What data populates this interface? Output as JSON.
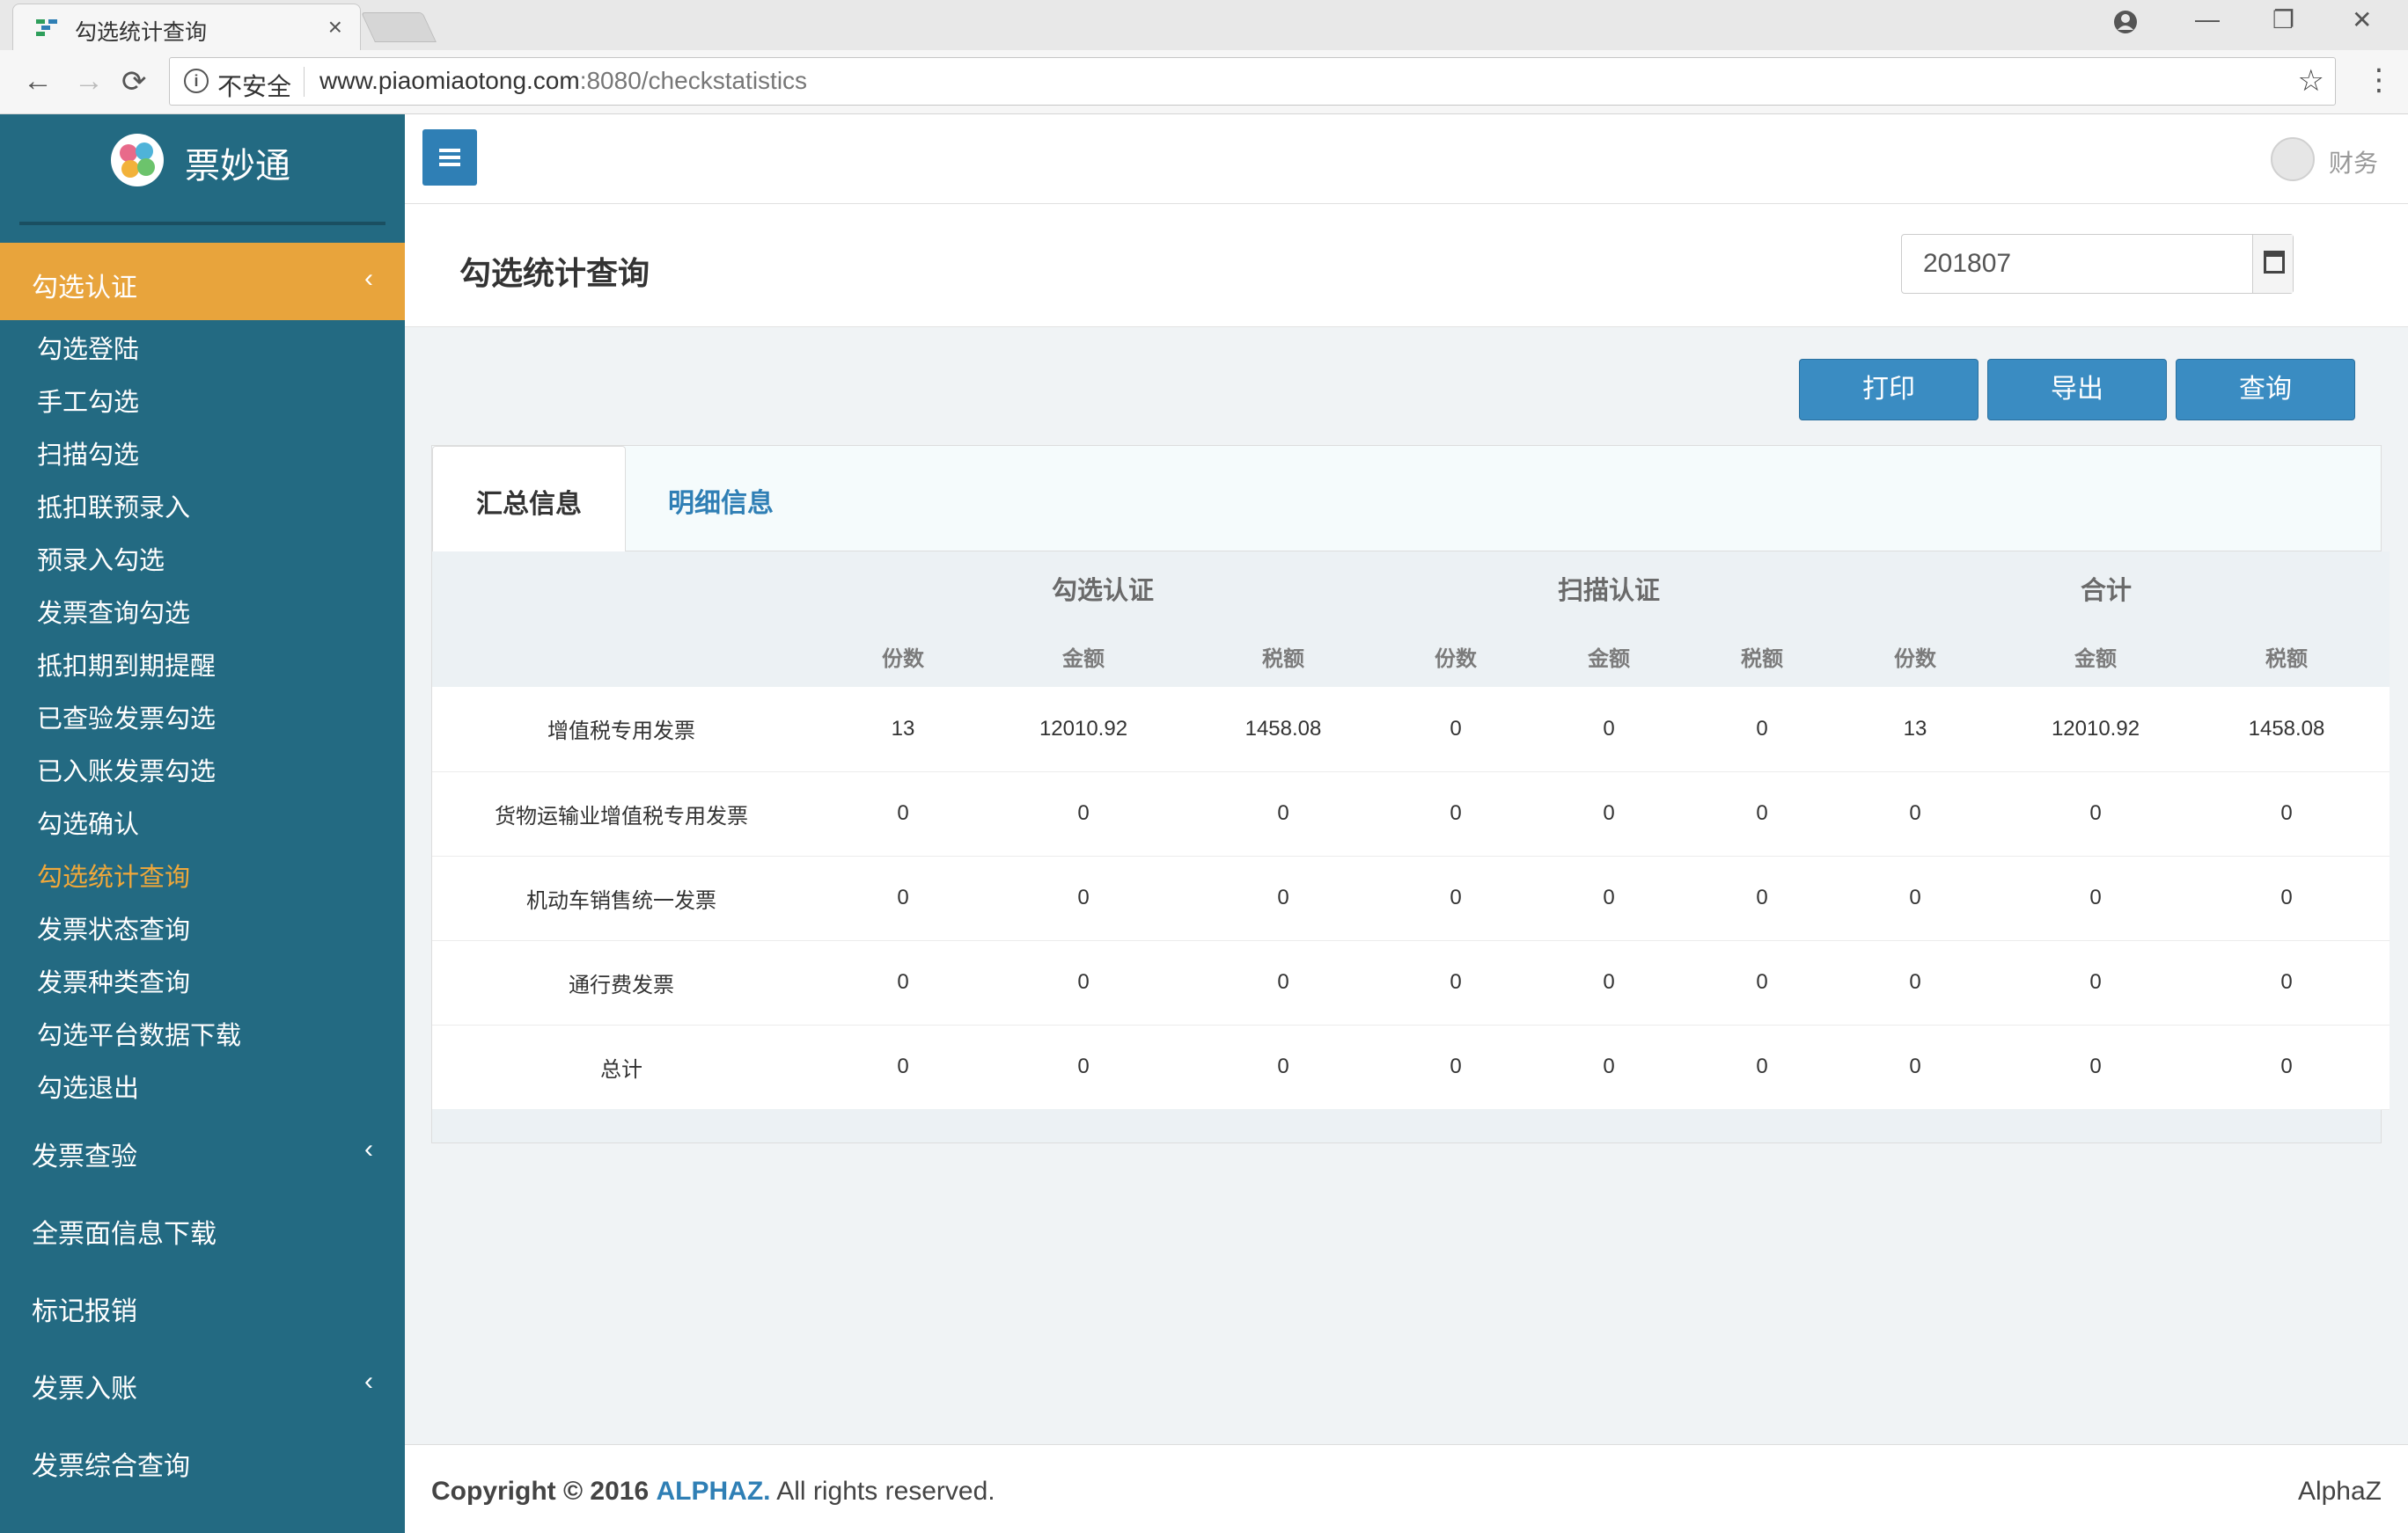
{
  "browser": {
    "tab_title": "勾选统计查询",
    "tab_close": "×",
    "insecure_label": "不安全",
    "url_host": "www.piaomiaotong.com",
    "url_rest": ":8080/checkstatistics",
    "back": "←",
    "forward": "→",
    "reload": "⟳",
    "star": "☆",
    "menu": "⋮",
    "minimize": "—",
    "restore": "❐",
    "close": "✕"
  },
  "sidebar": {
    "brand": "票妙通",
    "active_section": "勾选认证",
    "sub_items": [
      "勾选登陆",
      "手工勾选",
      "扫描勾选",
      "抵扣联预录入",
      "预录入勾选",
      "发票查询勾选",
      "抵扣期到期提醒",
      "已查验发票勾选",
      "已入账发票勾选",
      "勾选确认",
      "勾选统计查询",
      "发票状态查询",
      "发票种类查询",
      "勾选平台数据下载",
      "勾选退出"
    ],
    "top_items": [
      "发票查验",
      "全票面信息下载",
      "标记报销",
      "发票入账",
      "发票综合查询"
    ],
    "chevron": "‹"
  },
  "header": {
    "user": "财务"
  },
  "page": {
    "title": "勾选统计查询",
    "period_value": "201807",
    "buttons": {
      "print": "打印",
      "export": "导出",
      "query": "查询"
    }
  },
  "tabs": {
    "summary": "汇总信息",
    "detail": "明细信息"
  },
  "table": {
    "groups": [
      "勾选认证",
      "扫描认证",
      "合计"
    ],
    "subheaders": [
      "份数",
      "金额",
      "税额",
      "份数",
      "金额",
      "税额",
      "份数",
      "金额",
      "税额"
    ],
    "rows": [
      {
        "name": "增值税专用发票",
        "values": [
          "13",
          "12010.92",
          "1458.08",
          "0",
          "0",
          "0",
          "13",
          "12010.92",
          "1458.08"
        ]
      },
      {
        "name": "货物运输业增值税专用发票",
        "values": [
          "0",
          "0",
          "0",
          "0",
          "0",
          "0",
          "0",
          "0",
          "0"
        ]
      },
      {
        "name": "机动车销售统一发票",
        "values": [
          "0",
          "0",
          "0",
          "0",
          "0",
          "0",
          "0",
          "0",
          "0"
        ]
      },
      {
        "name": "通行费发票",
        "values": [
          "0",
          "0",
          "0",
          "0",
          "0",
          "0",
          "0",
          "0",
          "0"
        ]
      },
      {
        "name": "总计",
        "values": [
          "0",
          "0",
          "0",
          "0",
          "0",
          "0",
          "0",
          "0",
          "0"
        ]
      }
    ]
  },
  "footer": {
    "copyright_prefix": "Copyright © 2016",
    "brand": "ALPHAZ.",
    "suffix": "All rights reserved.",
    "right": "AlphaZ"
  },
  "colors": {
    "sidebar": "#236a82",
    "active": "#e8a43c",
    "primary": "#3a8cc2"
  }
}
